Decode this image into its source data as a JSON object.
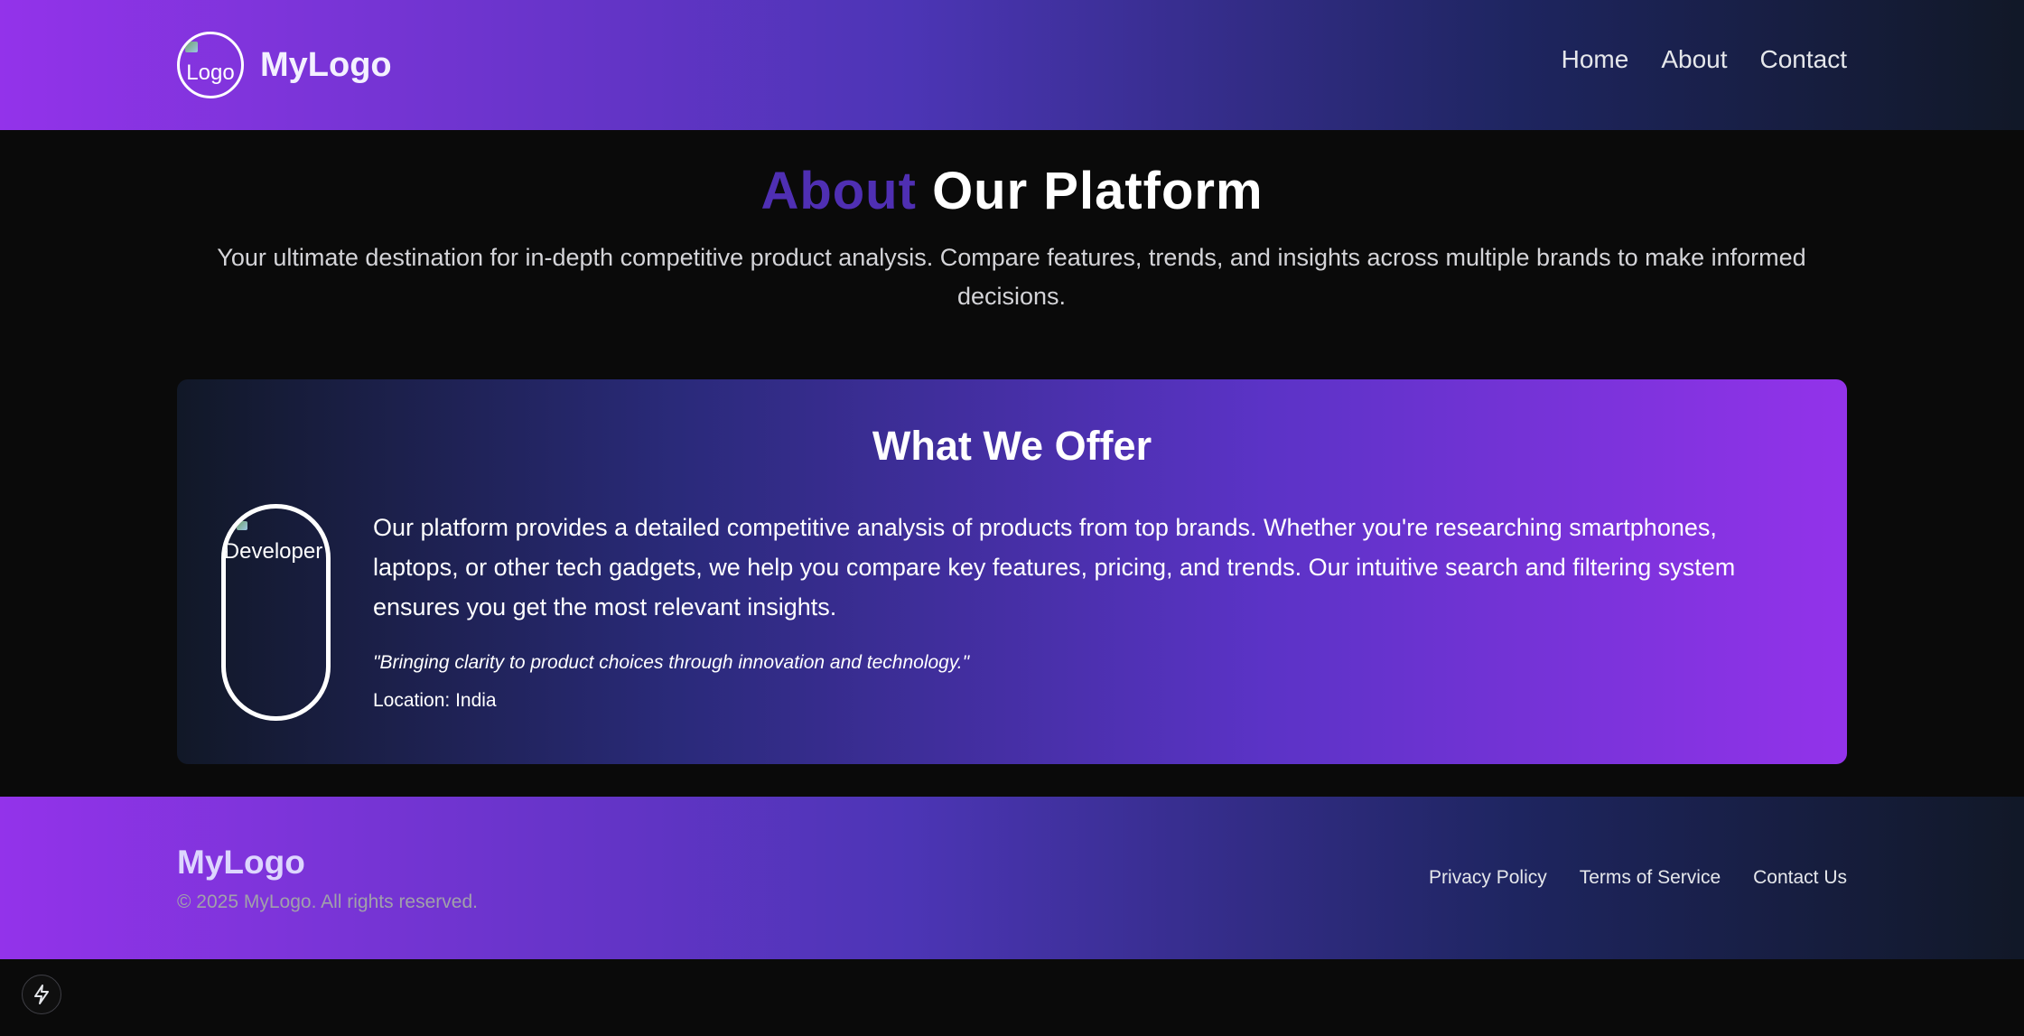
{
  "header": {
    "logo_alt": "Logo",
    "brand": "MyLogo",
    "nav": [
      "Home",
      "About",
      "Contact"
    ]
  },
  "hero": {
    "title_accent": "About",
    "title_rest": "Our Platform",
    "subtitle": "Your ultimate destination for in-depth competitive product analysis. Compare features, trends, and insights across multiple brands to make informed decisions."
  },
  "offer": {
    "title": "What We Offer",
    "image_alt": "Developer",
    "body": "Our platform provides a detailed competitive analysis of products from top brands. Whether you're researching smartphones, laptops, or other tech gadgets, we help you compare key features, pricing, and trends. Our intuitive search and filtering system ensures you get the most relevant insights.",
    "quote": "\"Bringing clarity to product choices through innovation and technology.\"",
    "location": "Location: India"
  },
  "footer": {
    "brand": "MyLogo",
    "copyright": "© 2025 MyLogo. All rights reserved.",
    "links": [
      "Privacy Policy",
      "Terms of Service",
      "Contact Us"
    ]
  },
  "colors": {
    "accent": "#4f2fb3",
    "gradient_start": "#9333ea",
    "gradient_end": "#111827",
    "background": "#0a0a0a"
  },
  "icons": {
    "fab": "lightning-bolt-icon"
  }
}
